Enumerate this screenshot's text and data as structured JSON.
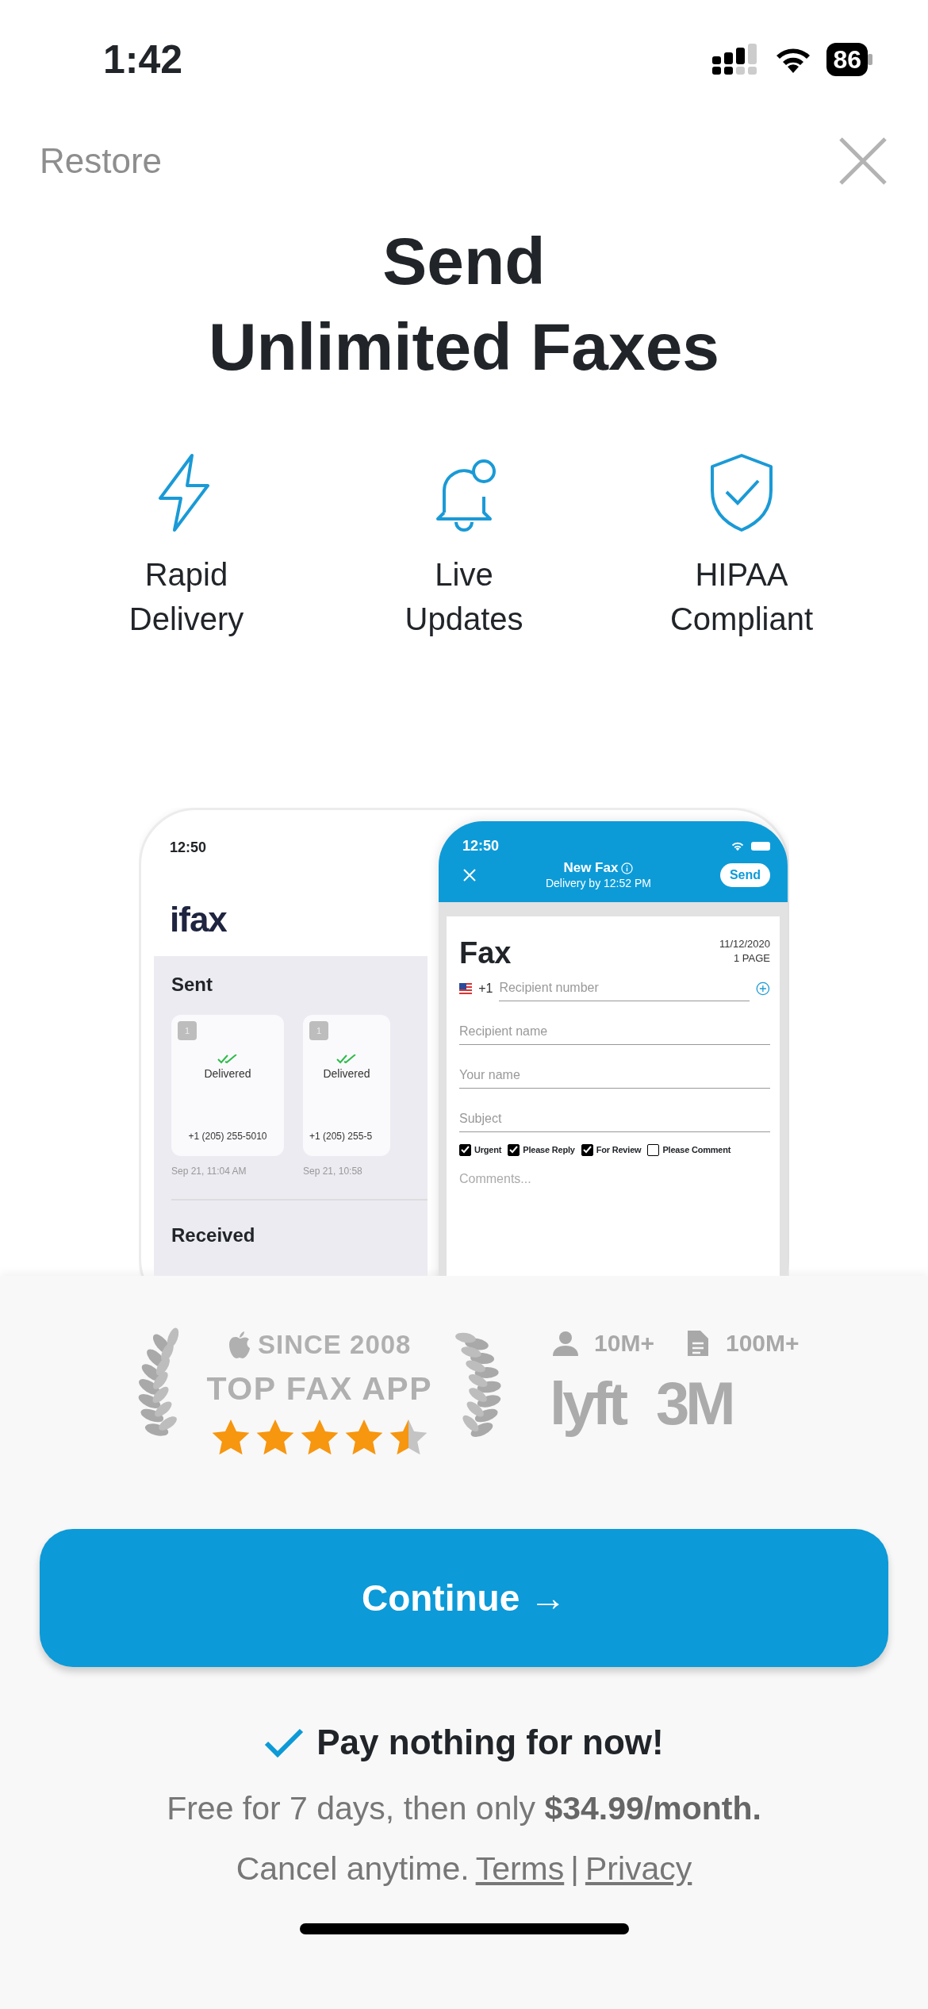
{
  "status_bar": {
    "time": "1:42",
    "battery": "86"
  },
  "header": {
    "restore": "Restore"
  },
  "title": "Send\nUnlimited Faxes",
  "features": [
    {
      "kind": "bolt",
      "label": "Rapid\nDelivery"
    },
    {
      "kind": "bell",
      "label": "Live\nUpdates"
    },
    {
      "kind": "shield",
      "label": "HIPAA\nCompliant"
    }
  ],
  "preview": {
    "back": {
      "time": "12:50",
      "logo": "ifax",
      "section": "Sent",
      "cards": [
        {
          "page": "1",
          "status": "Delivered",
          "number": "+1 (205) 255-5010",
          "date": "Sep 21, 11:04 AM"
        },
        {
          "page": "1",
          "status": "Delivered",
          "number": "+1 (205) 255-5",
          "date": "Sep 21, 10:58"
        }
      ],
      "section_2": "Received"
    },
    "front": {
      "time": "12:50",
      "title": "New Fax",
      "subtitle": "Delivery by 12:52 PM",
      "send": "Send",
      "heading": "Fax",
      "date": "11/12/2020",
      "pages": "1 PAGE",
      "fields": [
        {
          "placeholder": "Recipient number",
          "prefix": "+1"
        },
        {
          "placeholder": "Recipient name"
        },
        {
          "placeholder": "Your name"
        },
        {
          "placeholder": "Subject"
        }
      ],
      "options": [
        {
          "label": "Urgent",
          "checked": true
        },
        {
          "label": "Please Reply",
          "checked": true
        },
        {
          "label": "For Review",
          "checked": true
        },
        {
          "label": "Please Comment",
          "checked": false
        }
      ],
      "comments": "Comments..."
    }
  },
  "badge": {
    "since": "SINCE 2008",
    "title": "TOP FAX APP",
    "stars": 4.5
  },
  "stats": [
    {
      "kind": "user",
      "value": "10M+"
    },
    {
      "kind": "document",
      "value": "100M+"
    }
  ],
  "logos": [
    "lyft",
    "3M"
  ],
  "cta": {
    "label": "Continue →"
  },
  "offer": {
    "headline": "Pay nothing for now!",
    "terms": "Free for 7 days, then only **$34.99/month.**",
    "cancel": "Cancel anytime.",
    "links": [
      "Terms",
      "Privacy"
    ],
    "separator": "|"
  }
}
